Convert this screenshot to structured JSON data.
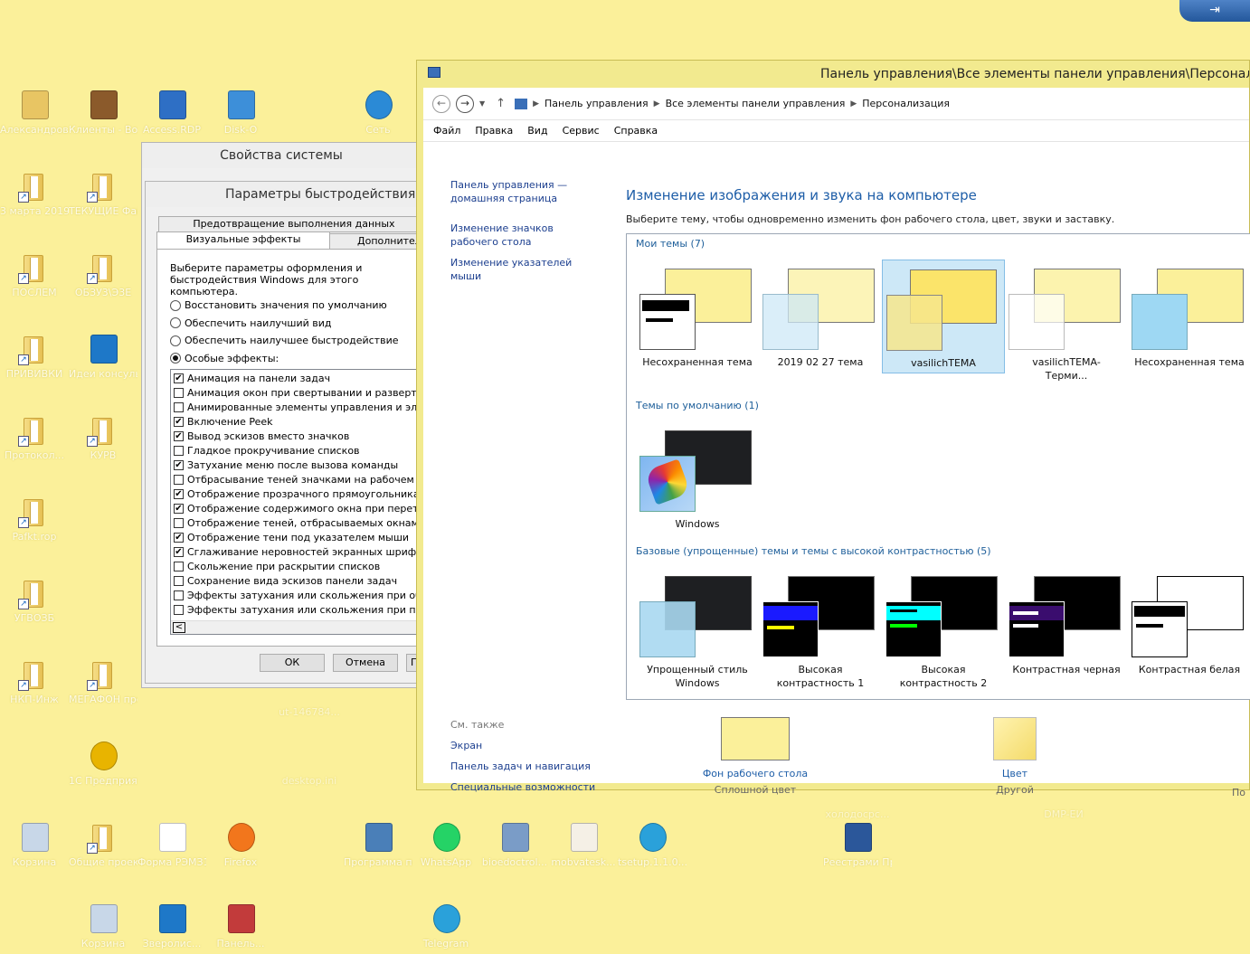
{
  "desktop": {
    "icons": [
      {
        "label": "Александров Сергей",
        "icon": "user-folder-icon"
      },
      {
        "label": "Клиенты - Вопрос",
        "icon": "briefcase-icon"
      },
      {
        "label": "Access.RDP",
        "icon": "remote-desktop-icon"
      },
      {
        "label": "Disk-O",
        "icon": "cloud-icon"
      },
      {
        "label": "Сеть",
        "icon": "network-icon"
      },
      {
        "label": "3 марта 2019",
        "icon": "folder-icon"
      },
      {
        "label": "ТЕКУЩИЕ Файлы",
        "icon": "folder-icon"
      },
      {
        "label": "ПОСЛЕМ",
        "icon": "folder-icon"
      },
      {
        "label": "ОБЗУ3\\Э3Е",
        "icon": "folder-icon"
      },
      {
        "label": "ПРИВИВКИ",
        "icon": "folder-icon"
      },
      {
        "label": "Идеи консульта...",
        "icon": "app-icon"
      },
      {
        "label": "Протокол...",
        "icon": "folder-icon"
      },
      {
        "label": "КУРВ",
        "icon": "folder-icon"
      },
      {
        "label": "Pafkt.rop",
        "icon": "folder-icon"
      },
      {
        "label": "УГВОЗБ",
        "icon": "folder-icon"
      },
      {
        "label": "НКП-Инж",
        "icon": "folder-icon"
      },
      {
        "label": "МЕГАФОН предложе...",
        "icon": "folder-icon"
      },
      {
        "label": "1С Предприя...",
        "icon": "1c-icon"
      },
      {
        "label": "Корзина",
        "icon": "recycle-bin-icon"
      },
      {
        "label": "Общие проекты",
        "icon": "folder-icon"
      },
      {
        "label": "Форма РЭМЗ1.pdf",
        "icon": "document-icon"
      },
      {
        "label": "Firefox",
        "icon": "firefox-icon"
      },
      {
        "label": "Программа подготовк...",
        "icon": "monitor-icon"
      },
      {
        "label": "WhatsApp",
        "icon": "whatsapp-icon"
      },
      {
        "label": "bioedoctrol...",
        "icon": "installer-icon"
      },
      {
        "label": "mobvatesk...",
        "icon": "archive-icon"
      },
      {
        "label": "tsetup.1.1.0...",
        "icon": "telegram-icon"
      },
      {
        "label": "Реестрами Прикатных",
        "icon": "word-icon"
      },
      {
        "label": "Корзина",
        "icon": "recycle-bin-icon"
      },
      {
        "label": "Зверолис...",
        "icon": "app-icon"
      },
      {
        "label": "Панель...",
        "icon": "control-panel-icon"
      },
      {
        "label": "Telegram",
        "icon": "telegram-icon"
      },
      {
        "label": "desktop.ini",
        "icon": "settings-file-icon"
      },
      {
        "label": "ut-146784...",
        "icon": "file-icon"
      },
      {
        "label": "холодосрс...",
        "icon": "file-icon"
      },
      {
        "label": "DMP-ЕИ",
        "icon": "file-icon"
      }
    ],
    "pin_symbol": "⇥"
  },
  "sysprops": {
    "title": "Свойства системы",
    "perf_title": "Параметры быстродействия",
    "tabs": {
      "dep": "Предотвращение выполнения данных",
      "visual": "Визуальные эффекты",
      "advanced": "Дополнительно"
    },
    "intro": "Выберите параметры оформления и быстродействия Windows для этого компьютера.",
    "radios": [
      {
        "label": "Восстановить значения по умолчанию",
        "selected": false
      },
      {
        "label": "Обеспечить наилучший вид",
        "selected": false
      },
      {
        "label": "Обеспечить наилучшее быстродействие",
        "selected": false
      },
      {
        "label": "Особые эффекты:",
        "selected": true
      }
    ],
    "effects": [
      {
        "label": "Анимация на панели задач",
        "checked": true
      },
      {
        "label": "Анимация окон при свертывании и развертывании",
        "checked": false
      },
      {
        "label": "Анимированные элементы управления и элементы",
        "checked": false
      },
      {
        "label": "Включение Peek",
        "checked": true
      },
      {
        "label": "Вывод эскизов вместо значков",
        "checked": true
      },
      {
        "label": "Гладкое прокручивание списков",
        "checked": false
      },
      {
        "label": "Затухание меню после вызова команды",
        "checked": true
      },
      {
        "label": "Отбрасывание теней значками на рабочем столе",
        "checked": false
      },
      {
        "label": "Отображение прозрачного прямоугольника выде",
        "checked": true
      },
      {
        "label": "Отображение содержимого окна при перетаскив",
        "checked": true
      },
      {
        "label": "Отображение теней, отбрасываемых окнами",
        "checked": false
      },
      {
        "label": "Отображение тени под указателем мыши",
        "checked": true
      },
      {
        "label": "Сглаживание неровностей экранных шрифтов",
        "checked": true
      },
      {
        "label": "Скольжение при раскрытии списков",
        "checked": false
      },
      {
        "label": "Сохранение вида эскизов панели задач",
        "checked": false
      },
      {
        "label": "Эффекты затухания или скольжения при обраще",
        "checked": false
      },
      {
        "label": "Эффекты затухания или скольжения при появле",
        "checked": false
      }
    ],
    "buttons": {
      "ok": "ОК",
      "cancel": "Отмена",
      "apply": "П"
    },
    "scroll_left": "<"
  },
  "cp": {
    "title": "Панель управления\\Все элементы панели управления\\Персонализация",
    "breadcrumb": [
      "Панель управления",
      "Все элементы панели управления",
      "Персонализация"
    ],
    "menu": [
      "Файл",
      "Правка",
      "Вид",
      "Сервис",
      "Справка"
    ],
    "left_nav": [
      "Панель управления — домашняя страница",
      "Изменение значков рабочего стола",
      "Изменение указателей мыши"
    ],
    "heading": "Изменение изображения и звука на компьютере",
    "subheading": "Выберите тему, чтобы одновременно изменить фон рабочего стола, цвет, звуки и заставку.",
    "groups": {
      "my": "Мои темы (7)",
      "default": "Темы по умолчанию (1)",
      "basic": "Базовые (упрощенные) темы и темы с высокой контрастностью (5)"
    },
    "my_themes": [
      {
        "label": "Несохраненная тема"
      },
      {
        "label": "2019 02 27 тема"
      },
      {
        "label": "vasilichTEMA"
      },
      {
        "label": "vasilichTEMA-Терми..."
      },
      {
        "label": "Несохраненная тема"
      }
    ],
    "default_themes": [
      {
        "label": "Windows"
      }
    ],
    "basic_themes": [
      {
        "label": "Упрощенный стиль Windows"
      },
      {
        "label": "Высокая контрастность 1"
      },
      {
        "label": "Высокая контрастность 2"
      },
      {
        "label": "Контрастная черная"
      },
      {
        "label": "Контрастная белая"
      }
    ],
    "see_also": {
      "heading": "См. также",
      "links": [
        "Экран",
        "Панель задач и навигация",
        "Специальные возможности"
      ]
    },
    "bottom_items": [
      {
        "link": "Фон рабочего стола",
        "value": "Сплошной цвет"
      },
      {
        "link": "Цвет",
        "value": "Другой"
      },
      {
        "link": "",
        "value": "По"
      }
    ]
  }
}
